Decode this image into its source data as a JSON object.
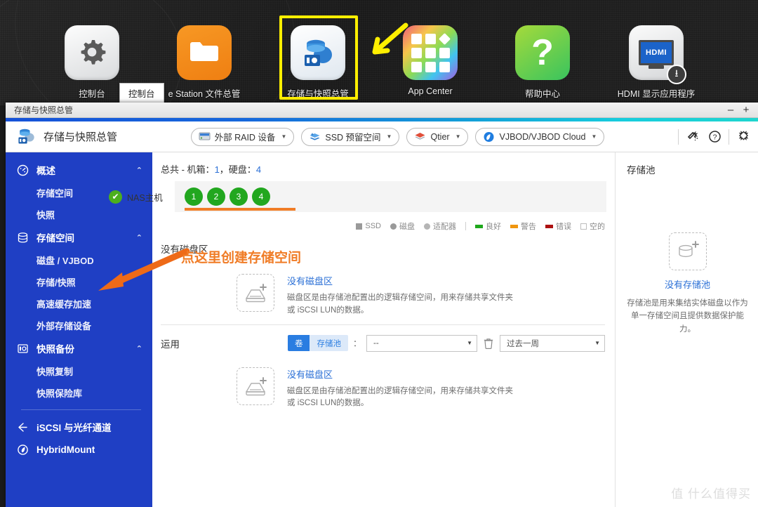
{
  "desktop": {
    "icons": [
      {
        "label": "控制台",
        "icon": "gear-icon"
      },
      {
        "label": "e Station 文件总管",
        "icon": "folder-icon"
      },
      {
        "label": "存储与快照总管",
        "icon": "storage-snapshot-icon"
      },
      {
        "label": "App Center",
        "icon": "app-grid-icon"
      },
      {
        "label": "帮助中心",
        "icon": "question-mark-icon"
      },
      {
        "label": "HDMI 显示应用程序",
        "icon": "hdmi-monitor-icon"
      }
    ],
    "tooltip": "控制台",
    "hdmi_badge": "HDMI",
    "highlight_color": "#ffef00"
  },
  "window": {
    "title": "存储与快照总管",
    "minimize": "–",
    "maximize": "+"
  },
  "toolbar": {
    "app_title": "存储与快照总管",
    "pills": [
      {
        "label": "外部 RAID 设备",
        "icon": "raid-enclosure-icon"
      },
      {
        "label": "SSD 预留空间",
        "icon": "ssd-overprovision-icon"
      },
      {
        "label": "Qtier",
        "icon": "qtier-layers-icon"
      },
      {
        "label": "VJBOD/VJBOD Cloud",
        "icon": "vjbod-cloud-icon"
      }
    ],
    "icons": [
      {
        "name": "wizard-icon",
        "glyph": "✧"
      },
      {
        "name": "help-icon",
        "glyph": "?"
      },
      {
        "name": "settings-icon",
        "glyph": "✲"
      }
    ]
  },
  "sidebar": {
    "groups": [
      {
        "label": "概述",
        "icon": "dashboard-icon",
        "chevron": "⌃",
        "items": [
          {
            "label": "存储空间"
          },
          {
            "label": "快照"
          }
        ]
      },
      {
        "label": "存储空间",
        "icon": "disk-stack-icon",
        "chevron": "⌃",
        "items": [
          {
            "label": "磁盘 / VJBOD"
          },
          {
            "label": "存储/快照"
          },
          {
            "label": "高速缓存加速"
          },
          {
            "label": "外部存储设备"
          }
        ]
      },
      {
        "label": "快照备份",
        "icon": "snapshot-icon",
        "chevron": "⌃",
        "items": [
          {
            "label": "快照复制"
          },
          {
            "label": "快照保险库"
          }
        ]
      }
    ],
    "flat_items": [
      {
        "label": "iSCSI 与光纤通道",
        "icon": "iscsi-icon"
      },
      {
        "label": "HybridMount",
        "icon": "hybridmount-icon"
      }
    ]
  },
  "main": {
    "total_prefix": "总共 - 机箱：",
    "total_enclosures": "1",
    "total_disk_label": "，硬盘：",
    "total_disks": "4",
    "nas_host": "NAS主机",
    "bays": [
      "1",
      "2",
      "3",
      "4"
    ],
    "legend": [
      {
        "label": "SSD",
        "shape": "square",
        "color": "#9a9a9a"
      },
      {
        "label": "磁盘",
        "shape": "circle",
        "color": "#9a9a9a"
      },
      {
        "label": "适配器",
        "shape": "circle",
        "color": "#b5b5b5"
      },
      {
        "label": "良好",
        "shape": "bar",
        "color": "#1fa81c"
      },
      {
        "label": "警告",
        "shape": "bar",
        "color": "#f0960f"
      },
      {
        "label": "错误",
        "shape": "bar",
        "color": "#ad1111"
      },
      {
        "label": "空的",
        "shape": "outline",
        "color": "#bdbdbd"
      }
    ],
    "volume_section_title": "没有磁盘区",
    "empty_volume": {
      "title": "没有磁盘区",
      "desc": "磁盘区是由存储池配置出的逻辑存储空间，用来存储共享文件夹或 iSCSI LUN的数据。"
    },
    "usage": {
      "title": "运用",
      "seg_volume": "卷",
      "seg_pool": "存储池",
      "colon": "：",
      "selected": "--",
      "time_range": "过去一周",
      "trash_icon": "trash-icon"
    },
    "empty_volume_bottom": {
      "title": "没有磁盘区",
      "desc": "磁盘区是由存储池配置出的逻辑存储空间，用来存储共享文件夹或 iSCSI LUN的数据。"
    }
  },
  "right_panel": {
    "title": "存储池",
    "link": "没有存储池",
    "desc": "存储池是用来集结实体磁盘以作为单一存储空间且提供数据保护能力。"
  },
  "annotation": {
    "text": "点这里创建存储空间",
    "color": "#f07c26"
  },
  "watermark": "值 什么值得买"
}
